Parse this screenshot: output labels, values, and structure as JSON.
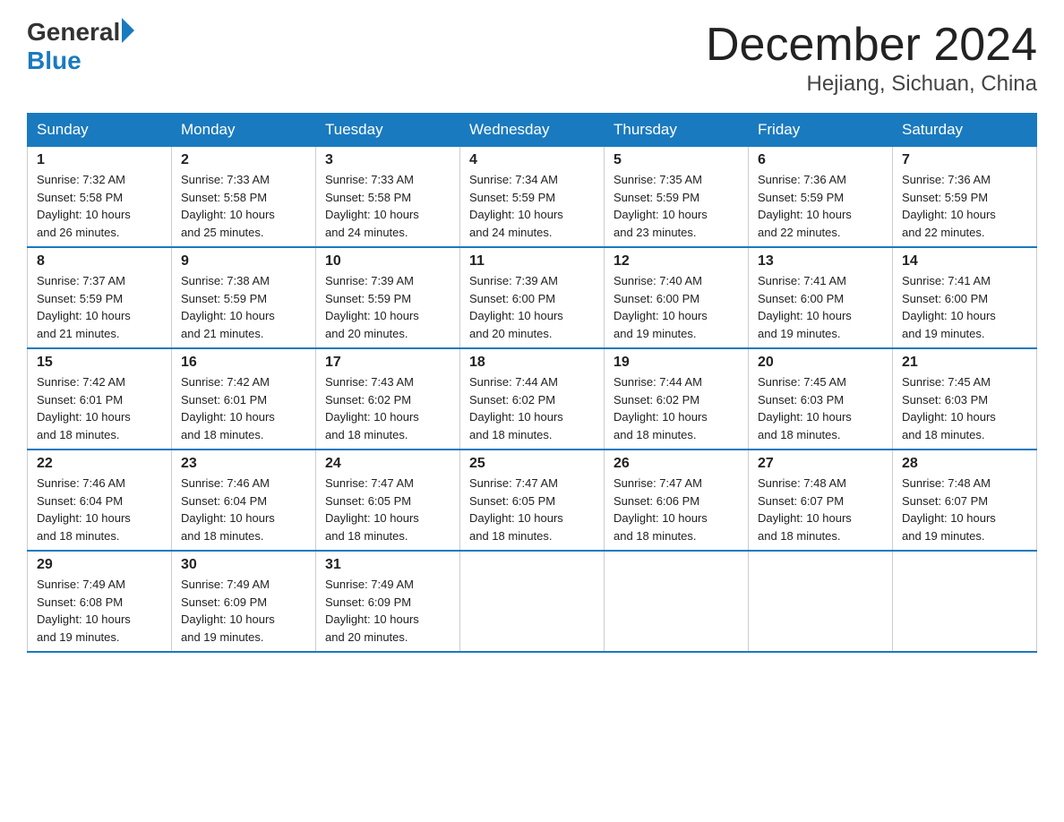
{
  "logo": {
    "general": "General",
    "blue": "Blue"
  },
  "title": {
    "month": "December 2024",
    "location": "Hejiang, Sichuan, China"
  },
  "headers": [
    "Sunday",
    "Monday",
    "Tuesday",
    "Wednesday",
    "Thursday",
    "Friday",
    "Saturday"
  ],
  "weeks": [
    [
      {
        "day": "1",
        "sunrise": "7:32 AM",
        "sunset": "5:58 PM",
        "daylight": "10 hours and 26 minutes."
      },
      {
        "day": "2",
        "sunrise": "7:33 AM",
        "sunset": "5:58 PM",
        "daylight": "10 hours and 25 minutes."
      },
      {
        "day": "3",
        "sunrise": "7:33 AM",
        "sunset": "5:58 PM",
        "daylight": "10 hours and 24 minutes."
      },
      {
        "day": "4",
        "sunrise": "7:34 AM",
        "sunset": "5:59 PM",
        "daylight": "10 hours and 24 minutes."
      },
      {
        "day": "5",
        "sunrise": "7:35 AM",
        "sunset": "5:59 PM",
        "daylight": "10 hours and 23 minutes."
      },
      {
        "day": "6",
        "sunrise": "7:36 AM",
        "sunset": "5:59 PM",
        "daylight": "10 hours and 22 minutes."
      },
      {
        "day": "7",
        "sunrise": "7:36 AM",
        "sunset": "5:59 PM",
        "daylight": "10 hours and 22 minutes."
      }
    ],
    [
      {
        "day": "8",
        "sunrise": "7:37 AM",
        "sunset": "5:59 PM",
        "daylight": "10 hours and 21 minutes."
      },
      {
        "day": "9",
        "sunrise": "7:38 AM",
        "sunset": "5:59 PM",
        "daylight": "10 hours and 21 minutes."
      },
      {
        "day": "10",
        "sunrise": "7:39 AM",
        "sunset": "5:59 PM",
        "daylight": "10 hours and 20 minutes."
      },
      {
        "day": "11",
        "sunrise": "7:39 AM",
        "sunset": "6:00 PM",
        "daylight": "10 hours and 20 minutes."
      },
      {
        "day": "12",
        "sunrise": "7:40 AM",
        "sunset": "6:00 PM",
        "daylight": "10 hours and 19 minutes."
      },
      {
        "day": "13",
        "sunrise": "7:41 AM",
        "sunset": "6:00 PM",
        "daylight": "10 hours and 19 minutes."
      },
      {
        "day": "14",
        "sunrise": "7:41 AM",
        "sunset": "6:00 PM",
        "daylight": "10 hours and 19 minutes."
      }
    ],
    [
      {
        "day": "15",
        "sunrise": "7:42 AM",
        "sunset": "6:01 PM",
        "daylight": "10 hours and 18 minutes."
      },
      {
        "day": "16",
        "sunrise": "7:42 AM",
        "sunset": "6:01 PM",
        "daylight": "10 hours and 18 minutes."
      },
      {
        "day": "17",
        "sunrise": "7:43 AM",
        "sunset": "6:02 PM",
        "daylight": "10 hours and 18 minutes."
      },
      {
        "day": "18",
        "sunrise": "7:44 AM",
        "sunset": "6:02 PM",
        "daylight": "10 hours and 18 minutes."
      },
      {
        "day": "19",
        "sunrise": "7:44 AM",
        "sunset": "6:02 PM",
        "daylight": "10 hours and 18 minutes."
      },
      {
        "day": "20",
        "sunrise": "7:45 AM",
        "sunset": "6:03 PM",
        "daylight": "10 hours and 18 minutes."
      },
      {
        "day": "21",
        "sunrise": "7:45 AM",
        "sunset": "6:03 PM",
        "daylight": "10 hours and 18 minutes."
      }
    ],
    [
      {
        "day": "22",
        "sunrise": "7:46 AM",
        "sunset": "6:04 PM",
        "daylight": "10 hours and 18 minutes."
      },
      {
        "day": "23",
        "sunrise": "7:46 AM",
        "sunset": "6:04 PM",
        "daylight": "10 hours and 18 minutes."
      },
      {
        "day": "24",
        "sunrise": "7:47 AM",
        "sunset": "6:05 PM",
        "daylight": "10 hours and 18 minutes."
      },
      {
        "day": "25",
        "sunrise": "7:47 AM",
        "sunset": "6:05 PM",
        "daylight": "10 hours and 18 minutes."
      },
      {
        "day": "26",
        "sunrise": "7:47 AM",
        "sunset": "6:06 PM",
        "daylight": "10 hours and 18 minutes."
      },
      {
        "day": "27",
        "sunrise": "7:48 AM",
        "sunset": "6:07 PM",
        "daylight": "10 hours and 18 minutes."
      },
      {
        "day": "28",
        "sunrise": "7:48 AM",
        "sunset": "6:07 PM",
        "daylight": "10 hours and 19 minutes."
      }
    ],
    [
      {
        "day": "29",
        "sunrise": "7:49 AM",
        "sunset": "6:08 PM",
        "daylight": "10 hours and 19 minutes."
      },
      {
        "day": "30",
        "sunrise": "7:49 AM",
        "sunset": "6:09 PM",
        "daylight": "10 hours and 19 minutes."
      },
      {
        "day": "31",
        "sunrise": "7:49 AM",
        "sunset": "6:09 PM",
        "daylight": "10 hours and 20 minutes."
      },
      null,
      null,
      null,
      null
    ]
  ],
  "labels": {
    "sunrise": "Sunrise:",
    "sunset": "Sunset:",
    "daylight": "Daylight:"
  }
}
